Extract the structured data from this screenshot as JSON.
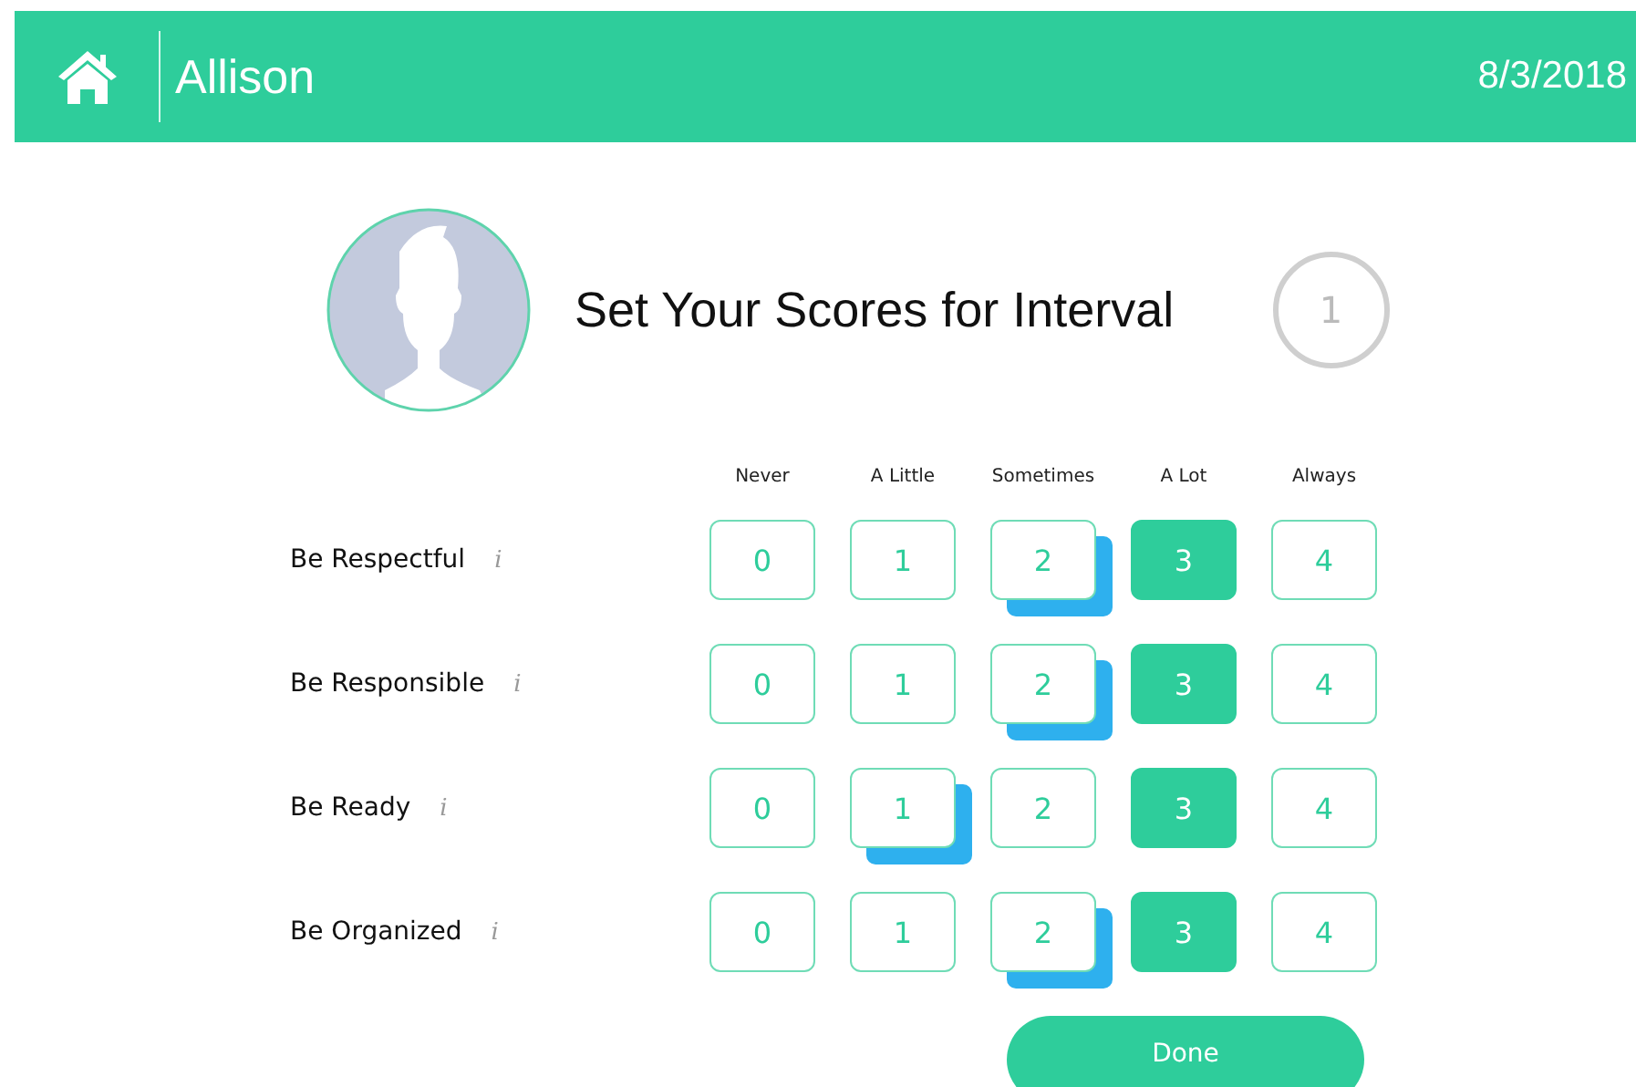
{
  "header": {
    "name": "Allison",
    "date": "8/3/2018"
  },
  "title": "Set Your Scores for Interval",
  "interval": "1",
  "scale": [
    "Never",
    "A Little",
    "Sometimes",
    "A Lot",
    "Always"
  ],
  "behaviors": [
    {
      "label": "Be Respectful",
      "info": "i",
      "options": [
        {
          "value": "0",
          "selected": false,
          "marked": false
        },
        {
          "value": "1",
          "selected": false,
          "marked": false
        },
        {
          "value": "2",
          "selected": false,
          "marked": true
        },
        {
          "value": "3",
          "selected": true,
          "marked": false
        },
        {
          "value": "4",
          "selected": false,
          "marked": false
        }
      ]
    },
    {
      "label": "Be Responsible",
      "info": "i",
      "options": [
        {
          "value": "0",
          "selected": false,
          "marked": false
        },
        {
          "value": "1",
          "selected": false,
          "marked": false
        },
        {
          "value": "2",
          "selected": false,
          "marked": true
        },
        {
          "value": "3",
          "selected": true,
          "marked": false
        },
        {
          "value": "4",
          "selected": false,
          "marked": false
        }
      ]
    },
    {
      "label": "Be Ready",
      "info": "i",
      "options": [
        {
          "value": "0",
          "selected": false,
          "marked": false
        },
        {
          "value": "1",
          "selected": false,
          "marked": true
        },
        {
          "value": "2",
          "selected": false,
          "marked": false
        },
        {
          "value": "3",
          "selected": true,
          "marked": false
        },
        {
          "value": "4",
          "selected": false,
          "marked": false
        }
      ]
    },
    {
      "label": "Be Organized",
      "info": "i",
      "options": [
        {
          "value": "0",
          "selected": false,
          "marked": false
        },
        {
          "value": "1",
          "selected": false,
          "marked": false
        },
        {
          "value": "2",
          "selected": false,
          "marked": true
        },
        {
          "value": "3",
          "selected": true,
          "marked": false
        },
        {
          "value": "4",
          "selected": false,
          "marked": false
        }
      ]
    }
  ],
  "done": "Done"
}
